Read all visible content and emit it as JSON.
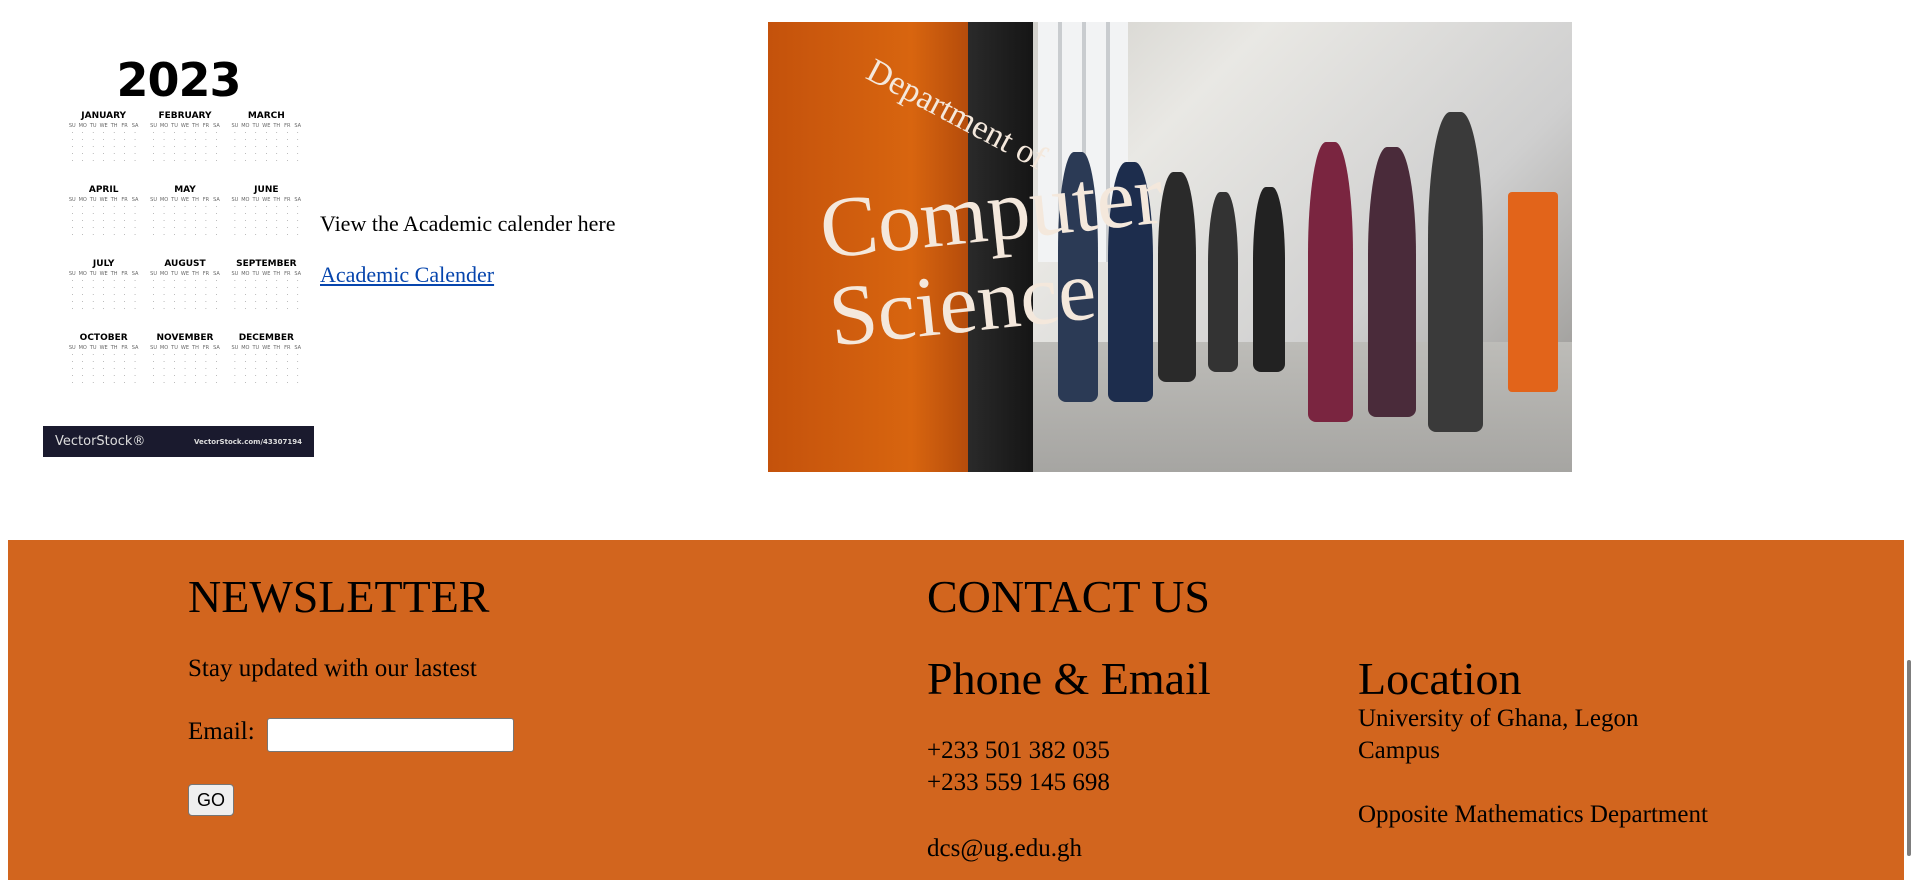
{
  "calendar": {
    "year": "2023",
    "months": [
      "JANUARY",
      "FEBRUARY",
      "MARCH",
      "APRIL",
      "MAY",
      "JUNE",
      "JULY",
      "AUGUST",
      "SEPTEMBER",
      "OCTOBER",
      "NOVEMBER",
      "DECEMBER"
    ],
    "weekdays": [
      "SU",
      "MO",
      "TU",
      "WE",
      "TH",
      "FR",
      "SA"
    ],
    "brand": "VectorStock®",
    "source": "VectorStock.com/43307194",
    "caption": "View the Academic calender here",
    "link_label": "Academic Calender"
  },
  "hero": {
    "banner_line1": "Department of",
    "banner_line2": "Computer\nScience"
  },
  "newsletter": {
    "title": "NEWSLETTER",
    "text": "Stay updated with our lastest",
    "email_label": "Email:",
    "email_value": "",
    "go_label": "GO"
  },
  "contact": {
    "title": "CONTACT US",
    "phone_email_title": "Phone & Email",
    "phones": [
      "+233 501 382 035",
      "+233 559 145 698"
    ],
    "email": "dcs@ug.edu.gh"
  },
  "location": {
    "title": "Location",
    "lines": [
      "University of Ghana, Legon",
      "Campus",
      "Opposite Mathematics Department"
    ]
  }
}
